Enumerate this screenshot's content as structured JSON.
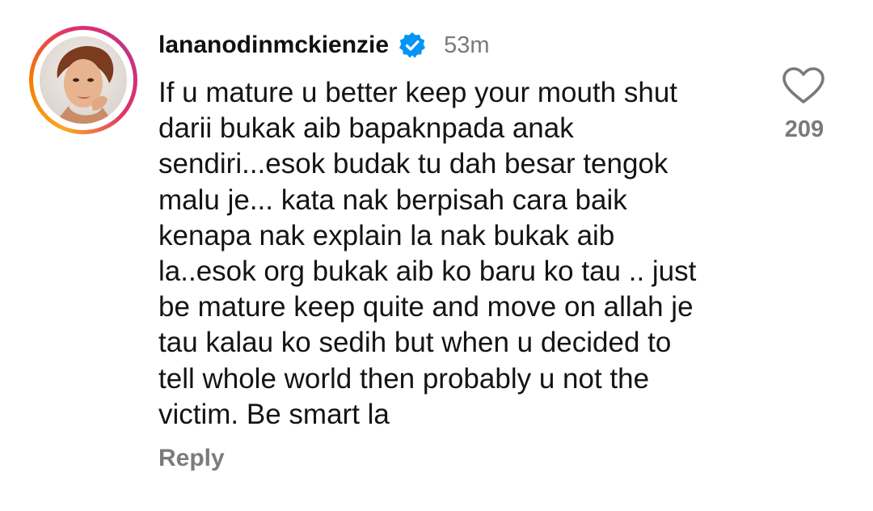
{
  "comment": {
    "username": "lananodinmckienzie",
    "verified": true,
    "timestamp": "53m",
    "text": "If u mature u better keep your mouth shut\ndarii bukak aib bapaknpada anak\nsendiri...esok budak tu dah besar tengok\nmalu je... kata nak berpisah cara baik\nkenapa nak explain la nak bukak aib\nla..esok org bukak aib ko baru ko tau .. just\nbe mature keep quite and move on allah je\ntau kalau ko sedih but when u decided to\ntell whole world then probably u not the\nvictim. Be smart la",
    "reply_label": "Reply",
    "like_count": "209"
  },
  "icons": {
    "avatar": "profile-photo",
    "verified": "verified-badge-icon",
    "like": "heart-outline-icon"
  },
  "colors": {
    "verified_blue": "#0095f6",
    "secondary_text": "#7a7a7a",
    "avatar_ring_gradient": [
      "#f9a825",
      "#f57c00",
      "#e1306c",
      "#c13584"
    ]
  }
}
